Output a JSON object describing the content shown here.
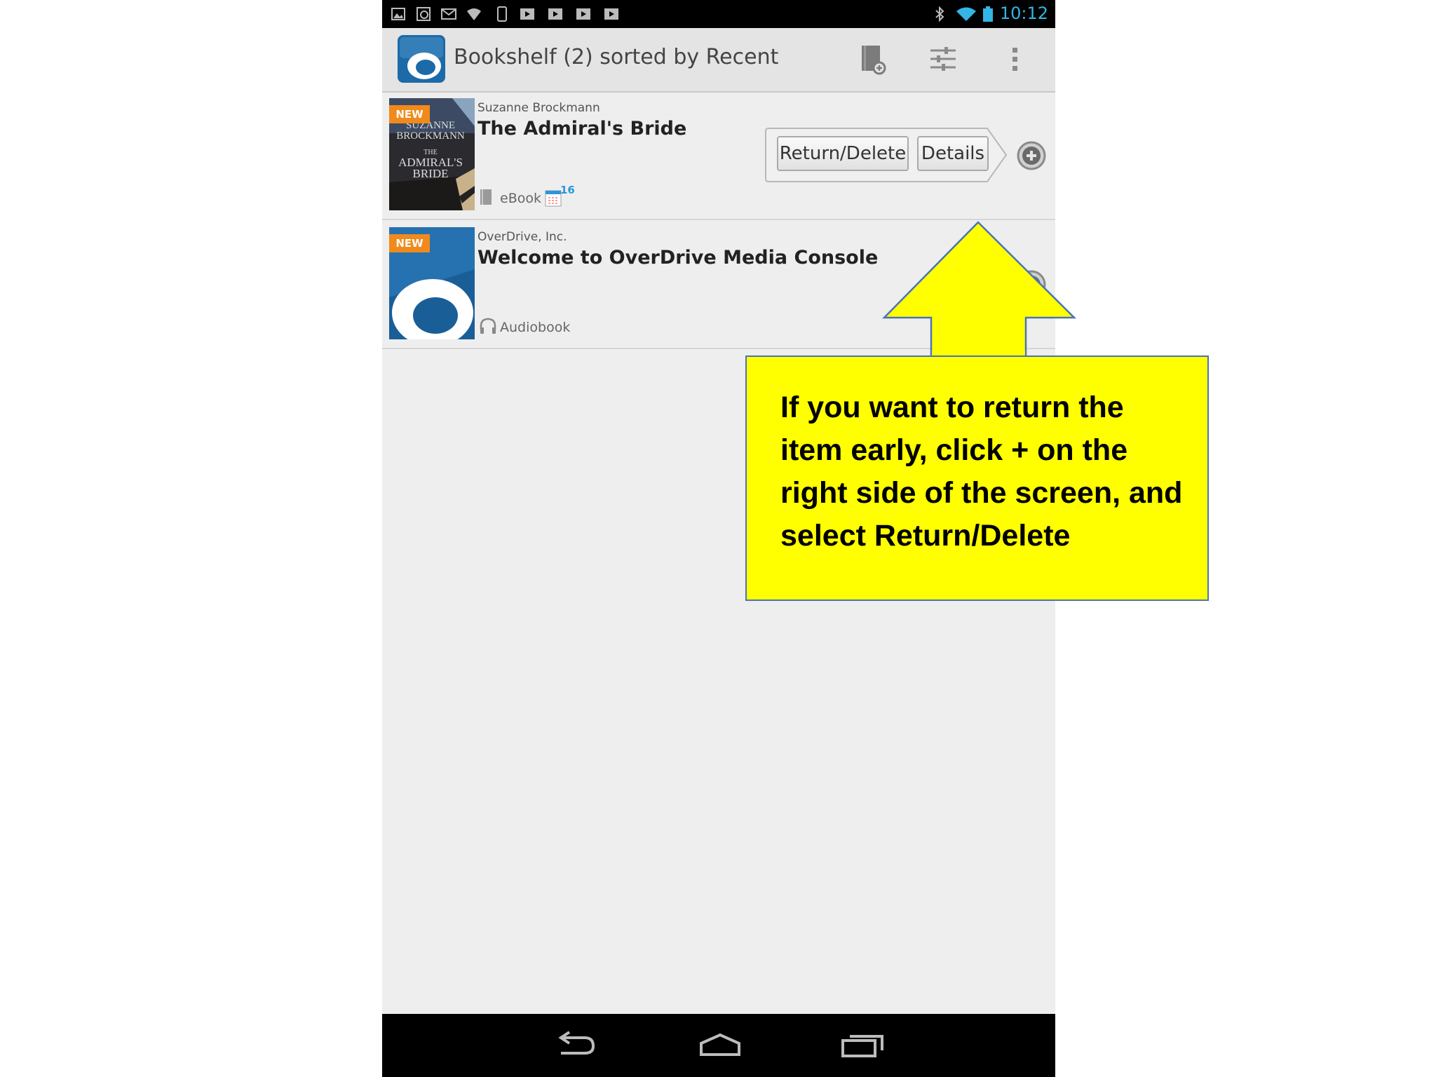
{
  "status_bar": {
    "time": "10:12",
    "left_icons": [
      "image-icon",
      "sync-icon",
      "gmail-icon",
      "wifi-alt-icon",
      "phone-icon",
      "play-icon",
      "play-icon",
      "play-icon",
      "play-icon"
    ],
    "right_icons": [
      "bluetooth-icon",
      "wifi-icon",
      "battery-icon"
    ]
  },
  "action_bar": {
    "title": "Bookshelf (2) sorted by Recent",
    "icons": [
      "overdrive-logo",
      "add-book-icon",
      "sort-filter-icon",
      "overflow-menu-icon"
    ]
  },
  "bookshelf": {
    "items": [
      {
        "badge": "NEW",
        "author": "Suzanne Brockmann",
        "title": "The Admiral's Bride",
        "format": "eBook",
        "due_days": "16",
        "cover_text": [
          "SUZANNE",
          "BROCKMANN",
          "THE",
          "ADMIRAL'S",
          "BRIDE"
        ]
      },
      {
        "badge": "NEW",
        "author": "OverDrive, Inc.",
        "title": "Welcome to OverDrive Media Console",
        "format": "Audiobook"
      }
    ]
  },
  "popup_menu": {
    "return_delete": "Return/Delete",
    "details": "Details"
  },
  "nav_bar": {
    "icons": [
      "back-icon",
      "home-icon",
      "recent-apps-icon"
    ]
  },
  "annotation": {
    "text": "If you want to return the\nitem early, click  +  on the\nright side of the screen, and\nselect Return/Delete",
    "box_color": "#ffff00",
    "border_color": "#4a73b8"
  }
}
